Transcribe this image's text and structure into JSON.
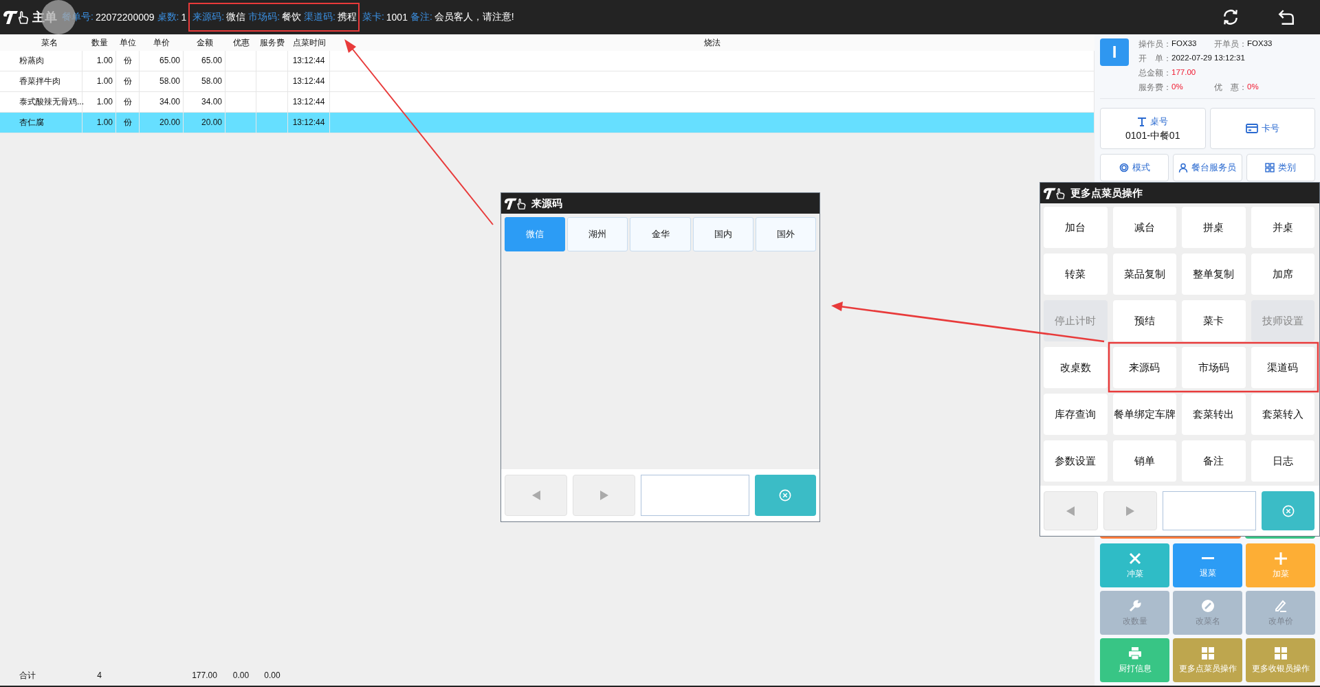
{
  "header": {
    "title": "主单",
    "fields": [
      {
        "label": "餐单号:",
        "value": "22072200009"
      },
      {
        "label": "桌数:",
        "value": "1"
      },
      {
        "label": "来源码:",
        "value": "微信"
      },
      {
        "label": "市场码:",
        "value": "餐饮"
      },
      {
        "label": "渠道码:",
        "value": "携程"
      },
      {
        "label": "菜卡:",
        "value": "1001"
      },
      {
        "label": "备注:",
        "value": "会员客人，请注意!"
      }
    ]
  },
  "table": {
    "columns": [
      "菜名",
      "数量",
      "单位",
      "单价",
      "金额",
      "优惠",
      "服务费",
      "点菜时间",
      "烧法"
    ],
    "rows": [
      {
        "cells": [
          "粉蒸肉",
          "1.00",
          "份",
          "65.00",
          "65.00",
          "",
          "",
          "13:12:44",
          ""
        ],
        "selected": false
      },
      {
        "cells": [
          "香菜拌牛肉",
          "1.00",
          "份",
          "58.00",
          "58.00",
          "",
          "",
          "13:12:44",
          ""
        ],
        "selected": false
      },
      {
        "cells": [
          "泰式酸辣无骨鸡...",
          "1.00",
          "份",
          "34.00",
          "34.00",
          "",
          "",
          "13:12:44",
          ""
        ],
        "selected": false
      },
      {
        "cells": [
          "杏仁腐",
          "1.00",
          "份",
          "20.00",
          "20.00",
          "",
          "",
          "13:12:44",
          ""
        ],
        "selected": true
      }
    ],
    "totals": {
      "label": "合计",
      "count": "4",
      "amount": "177.00",
      "discount": "0.00",
      "service": "0.00"
    }
  },
  "summary": {
    "badge": "I",
    "lines": [
      [
        {
          "label": "操作员：",
          "value": "FOX33",
          "highlight": false
        },
        {
          "label": "开单员：",
          "value": "FOX33",
          "highlight": false
        }
      ],
      [
        {
          "label": "开　单：",
          "value": "2022-07-29 13:12:31",
          "highlight": false
        }
      ],
      [
        {
          "label": "总金额：",
          "value": "177.00",
          "highlight": true
        }
      ],
      [
        {
          "label": "服务费：",
          "value": "0%",
          "highlight": true
        },
        {
          "label": "优　惠：",
          "value": "0%",
          "highlight": true
        }
      ]
    ]
  },
  "table_button": {
    "label": "桌号",
    "value": "0101-中餐01"
  },
  "card_button": {
    "label": "卡号"
  },
  "mode_buttons": [
    {
      "label": "模式",
      "kind": "mode"
    },
    {
      "label": "餐台服务员",
      "kind": "waiter"
    },
    {
      "label": "类别",
      "kind": "category"
    }
  ],
  "quick_actions": [
    {
      "label": "冲菜",
      "kind": "cross",
      "color": "#2fbcc6",
      "disabled": false
    },
    {
      "label": "退菜",
      "kind": "minus",
      "color": "#2c9cf5",
      "disabled": false
    },
    {
      "label": "加菜",
      "kind": "plus",
      "color": "#fdae35",
      "disabled": false
    },
    {
      "label": "改数量",
      "kind": "wrench",
      "color": "#abbccc",
      "disabled": true
    },
    {
      "label": "改菜名",
      "kind": "pencil-circle",
      "color": "#abbccc",
      "disabled": true
    },
    {
      "label": "改单价",
      "kind": "pen",
      "color": "#abbccc",
      "disabled": true
    },
    {
      "label": "厨打信息",
      "kind": "printer",
      "color": "#38c585",
      "disabled": false
    },
    {
      "label": "更多点菜员操作",
      "kind": "grid",
      "color": "#bea64e",
      "disabled": false
    },
    {
      "label": "更多收银员操作",
      "kind": "grid",
      "color": "#bea64e",
      "disabled": false
    }
  ],
  "source_dialog": {
    "title": "来源码",
    "options": [
      {
        "label": "微信",
        "selected": true
      },
      {
        "label": "湖州",
        "selected": false
      },
      {
        "label": "金华",
        "selected": false
      },
      {
        "label": "国内",
        "selected": false
      },
      {
        "label": "国外",
        "selected": false
      }
    ]
  },
  "more_dialog": {
    "title": "更多点菜员操作",
    "buttons": [
      {
        "label": "加台",
        "disabled": false
      },
      {
        "label": "减台",
        "disabled": false
      },
      {
        "label": "拼桌",
        "disabled": false
      },
      {
        "label": "并桌",
        "disabled": false
      },
      {
        "label": "转菜",
        "disabled": false
      },
      {
        "label": "菜品复制",
        "disabled": false
      },
      {
        "label": "整单复制",
        "disabled": false
      },
      {
        "label": "加席",
        "disabled": false
      },
      {
        "label": "停止计时",
        "disabled": true
      },
      {
        "label": "预结",
        "disabled": false
      },
      {
        "label": "菜卡",
        "disabled": false
      },
      {
        "label": "技师设置",
        "disabled": true
      },
      {
        "label": "改桌数",
        "disabled": false
      },
      {
        "label": "来源码",
        "disabled": false
      },
      {
        "label": "市场码",
        "disabled": false
      },
      {
        "label": "渠道码",
        "disabled": false
      },
      {
        "label": "库存查询",
        "disabled": false
      },
      {
        "label": "餐单绑定车牌",
        "disabled": false
      },
      {
        "label": "套菜转出",
        "disabled": false
      },
      {
        "label": "套菜转入",
        "disabled": false
      },
      {
        "label": "参数设置",
        "disabled": false
      },
      {
        "label": "销单",
        "disabled": false
      },
      {
        "label": "备注",
        "disabled": false
      },
      {
        "label": "日志",
        "disabled": false
      }
    ]
  }
}
